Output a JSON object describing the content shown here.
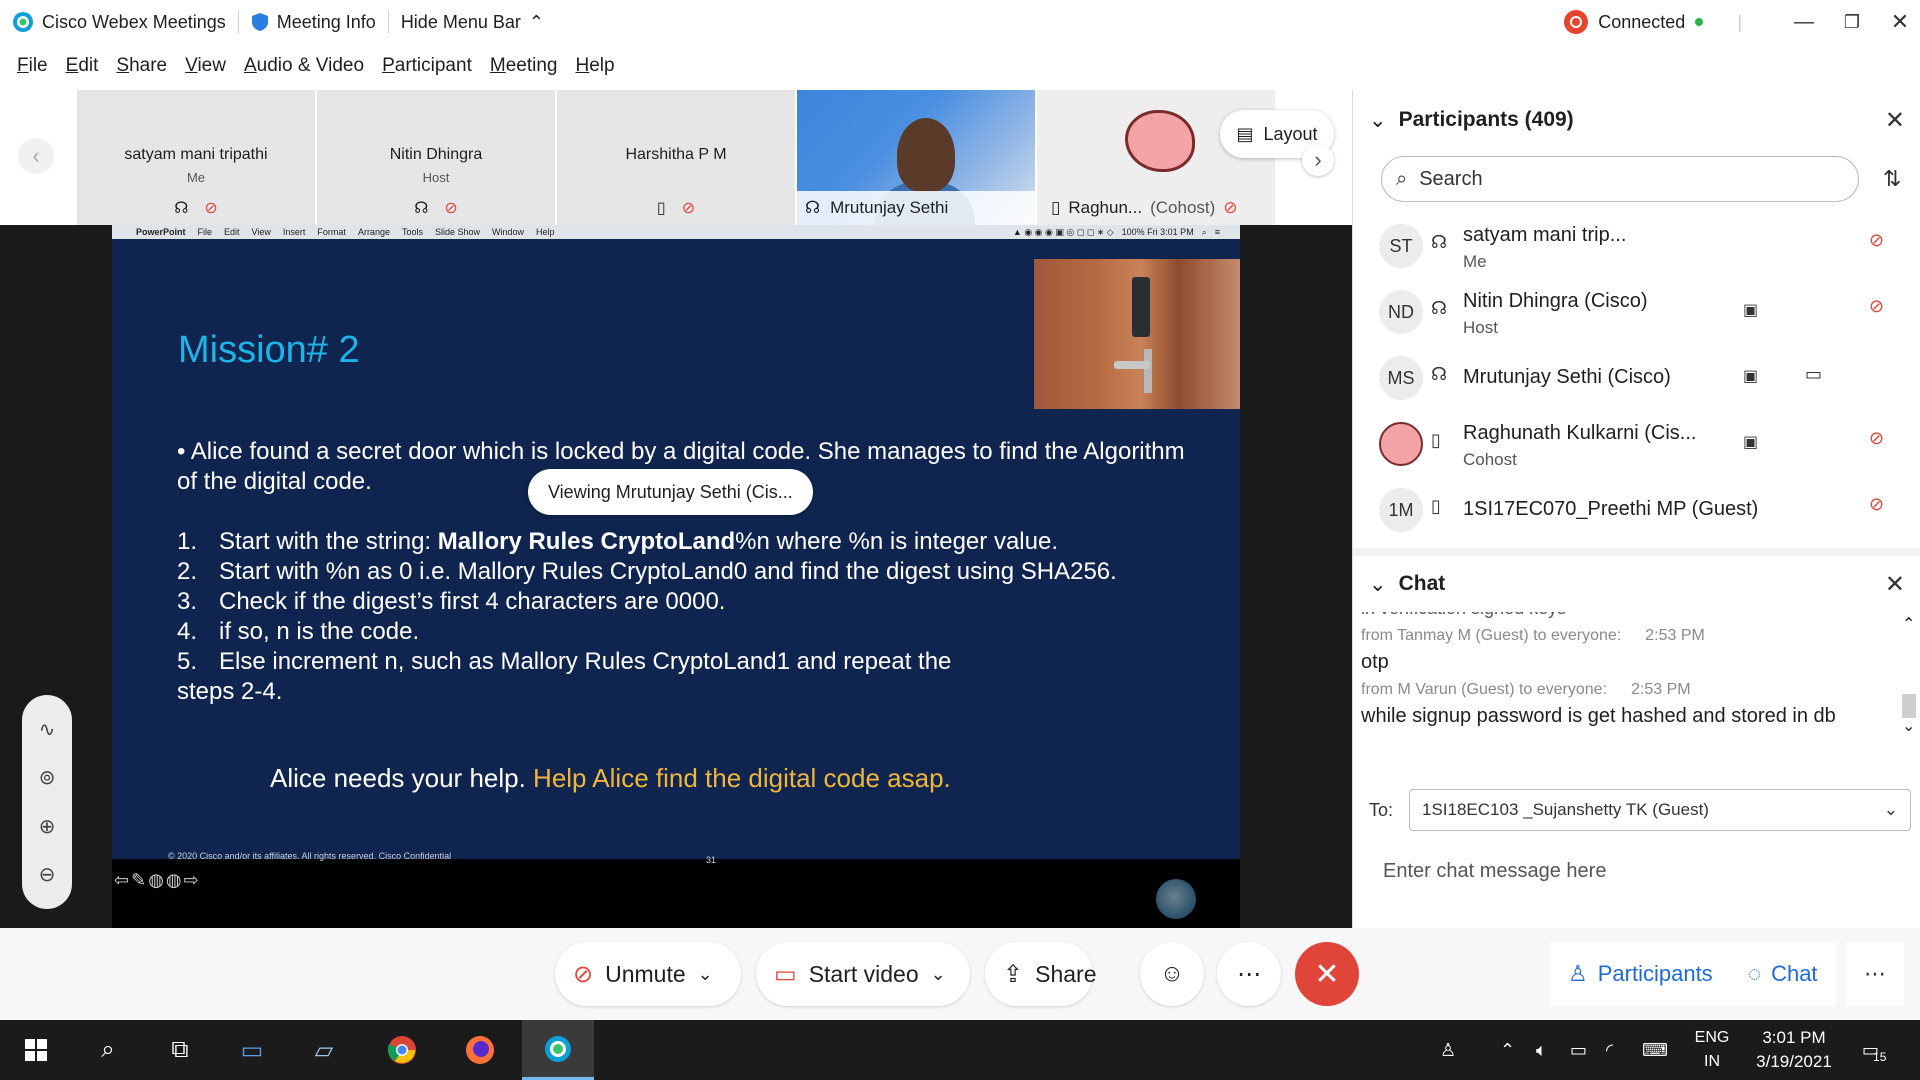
{
  "window": {
    "app_title": "Cisco Webex Meetings",
    "meeting_info": "Meeting Info",
    "hide_menu": "Hide Menu Bar",
    "status": "Connected"
  },
  "menu": [
    "File",
    "Edit",
    "Share",
    "View",
    "Audio & Video",
    "Participant",
    "Meeting",
    "Help"
  ],
  "thumbnails": [
    {
      "name": "satyam mani tripathi",
      "role": "Me"
    },
    {
      "name": "Nitin Dhingra",
      "role": "Host"
    },
    {
      "name": "Harshitha P M",
      "role": ""
    }
  ],
  "video_thumb": {
    "name": "Mrutunjay Sethi"
  },
  "raghu_thumb": {
    "name": "Raghun...",
    "role": "(Cohost)"
  },
  "layout_label": "Layout",
  "viewing_banner": "Viewing Mrutunjay Sethi (Cis...",
  "mac_menu": {
    "app": "PowerPoint",
    "items": [
      "File",
      "Edit",
      "View",
      "Insert",
      "Format",
      "Arrange",
      "Tools",
      "Slide Show",
      "Window",
      "Help"
    ],
    "right": "100%  Fri 3:01 PM"
  },
  "slide": {
    "title": "Mission# 2",
    "bullet": "•   Alice found a secret door which is locked by a digital code. She manages to find the Algorithm of the digital code.",
    "step1_prefix": "Start with the string: ",
    "step1_bold": "Mallory Rules CryptoLand",
    "step1_suffix": "%n where %n is integer value.",
    "steps": [
      {
        "n": "1.",
        "text": ""
      },
      {
        "n": "2.",
        "text": "Start with %n as 0 i.e. Mallory Rules CryptoLand0 and find the digest using SHA256."
      },
      {
        "n": "3.",
        "text": "Check if the digest’s first 4 characters are 0000."
      },
      {
        "n": "4.",
        "text": "if so, n is the code."
      },
      {
        "n": "5.",
        "text": "Else increment n, such as Mallory Rules CryptoLand1 and repeat the"
      }
    ],
    "step5_cont": "steps 2-4.",
    "help_white": "Alice needs your help. ",
    "help_orange": "Help Alice find the digital code asap.",
    "footer": "© 2020  Cisco and/or its affiliates. All rights reserved.   Cisco Confidential",
    "page": "31",
    "accent_title": "#1fb4e8",
    "accent_help": "#f1b53a",
    "background": "#0f2550"
  },
  "participants_panel": {
    "title": "Participants (409)",
    "search_placeholder": "Search",
    "rows": [
      {
        "initials": "ST",
        "name": "satyam mani trip...",
        "role": "Me"
      },
      {
        "initials": "ND",
        "name": "Nitin Dhingra (Cisco)",
        "role": "Host"
      },
      {
        "initials": "MS",
        "name": "Mrutunjay Sethi (Cisco)",
        "role": ""
      },
      {
        "initials": "",
        "name": "Raghunath Kulkarni (Cis...",
        "role": "Cohost"
      },
      {
        "initials": "1M",
        "name": "1SI17EC070_Preethi MP (Guest)",
        "role": ""
      }
    ]
  },
  "chat_panel": {
    "title": "Chat",
    "partial_line": "in verification signed keys",
    "messages": [
      {
        "from": "from Tanmay M (Guest) to everyone:",
        "time": "2:53 PM",
        "text": "otp"
      },
      {
        "from": "from M Varun (Guest) to everyone:",
        "time": "2:53 PM",
        "text": "while signup password is get hashed and stored in db"
      }
    ],
    "to_label": "To:",
    "to_value": "1SI18EC103 _Sujanshetty TK (Guest)",
    "input_placeholder": "Enter chat message here"
  },
  "controls": {
    "unmute": "Unmute",
    "start_video": "Start video",
    "share": "Share",
    "participants": "Participants",
    "chat": "Chat",
    "end_color": "#e0453a"
  },
  "taskbar": {
    "lang_top": "ENG",
    "lang_bottom": "IN",
    "time": "3:01 PM",
    "date": "3/19/2021",
    "notifications": "15"
  }
}
